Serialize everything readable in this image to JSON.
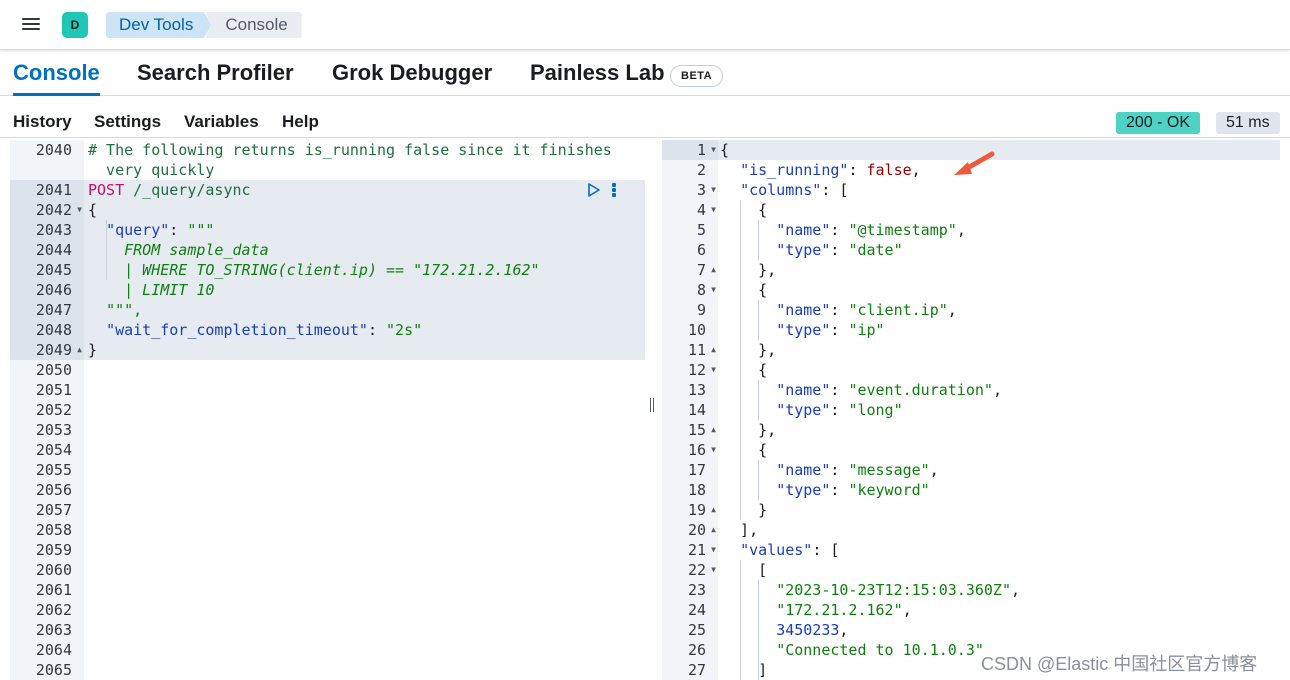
{
  "header": {
    "avatar_letter": "D",
    "breadcrumbs": [
      "Dev Tools",
      "Console"
    ]
  },
  "tabs": [
    {
      "label": "Console",
      "active": true
    },
    {
      "label": "Search Profiler",
      "active": false
    },
    {
      "label": "Grok Debugger",
      "active": false
    },
    {
      "label": "Painless Lab",
      "active": false
    }
  ],
  "beta_badge": "BETA",
  "toolbar": {
    "items": [
      "History",
      "Settings",
      "Variables",
      "Help"
    ],
    "status": "200 - OK",
    "duration": "51 ms"
  },
  "request": {
    "line_numbers": [
      "2040",
      "",
      "2041",
      "2042",
      "2043",
      "2044",
      "2045",
      "2046",
      "2047",
      "2048",
      "2049",
      "2050",
      "2051",
      "2052",
      "2053",
      "2054",
      "2055",
      "2056",
      "2057",
      "2058",
      "2059",
      "2060",
      "2061",
      "2062",
      "2063",
      "2064",
      "2065"
    ],
    "comment_line_1": "# The following returns is_running false since it finishes",
    "comment_line_2": "  very quickly",
    "method": "POST",
    "path": "/_query/async",
    "lines": {
      "open_brace": "{",
      "query_key": "\"query\"",
      "query_sep": ": ",
      "query_open": "\"\"\"",
      "from_line": "FROM sample_data",
      "where_line": "| WHERE TO_STRING(client.ip) == \"172.21.2.162\"",
      "limit_line": "| LIMIT 10",
      "query_close": "\"\"\",",
      "timeout_key": "\"wait_for_completion_timeout\"",
      "timeout_sep": ": ",
      "timeout_val": "\"2s\"",
      "close_brace": "}"
    }
  },
  "response": {
    "line_numbers": [
      "1",
      "2",
      "3",
      "4",
      "5",
      "6",
      "7",
      "8",
      "9",
      "10",
      "11",
      "12",
      "13",
      "14",
      "15",
      "16",
      "17",
      "18",
      "19",
      "20",
      "21",
      "22",
      "23",
      "24",
      "25",
      "26",
      "27"
    ],
    "is_running_key": "\"is_running\"",
    "is_running_val": "false",
    "columns_key": "\"columns\"",
    "values_key": "\"values\"",
    "name_key": "\"name\"",
    "type_key": "\"type\"",
    "columns": [
      {
        "name": "\"@timestamp\"",
        "type": "\"date\""
      },
      {
        "name": "\"client.ip\"",
        "type": "\"ip\""
      },
      {
        "name": "\"event.duration\"",
        "type": "\"long\""
      },
      {
        "name": "\"message\"",
        "type": "\"keyword\""
      }
    ],
    "values_row": [
      "\"2023-10-23T12:15:03.360Z\"",
      "\"172.21.2.162\"",
      "3450233",
      "\"Connected to 10.1.0.3\""
    ]
  },
  "watermark": "CSDN @Elastic 中国社区官方博客",
  "colors": {
    "accent": "#0071c2",
    "status_ok": "#4dd2c3",
    "arrow": "#f05a3c"
  }
}
